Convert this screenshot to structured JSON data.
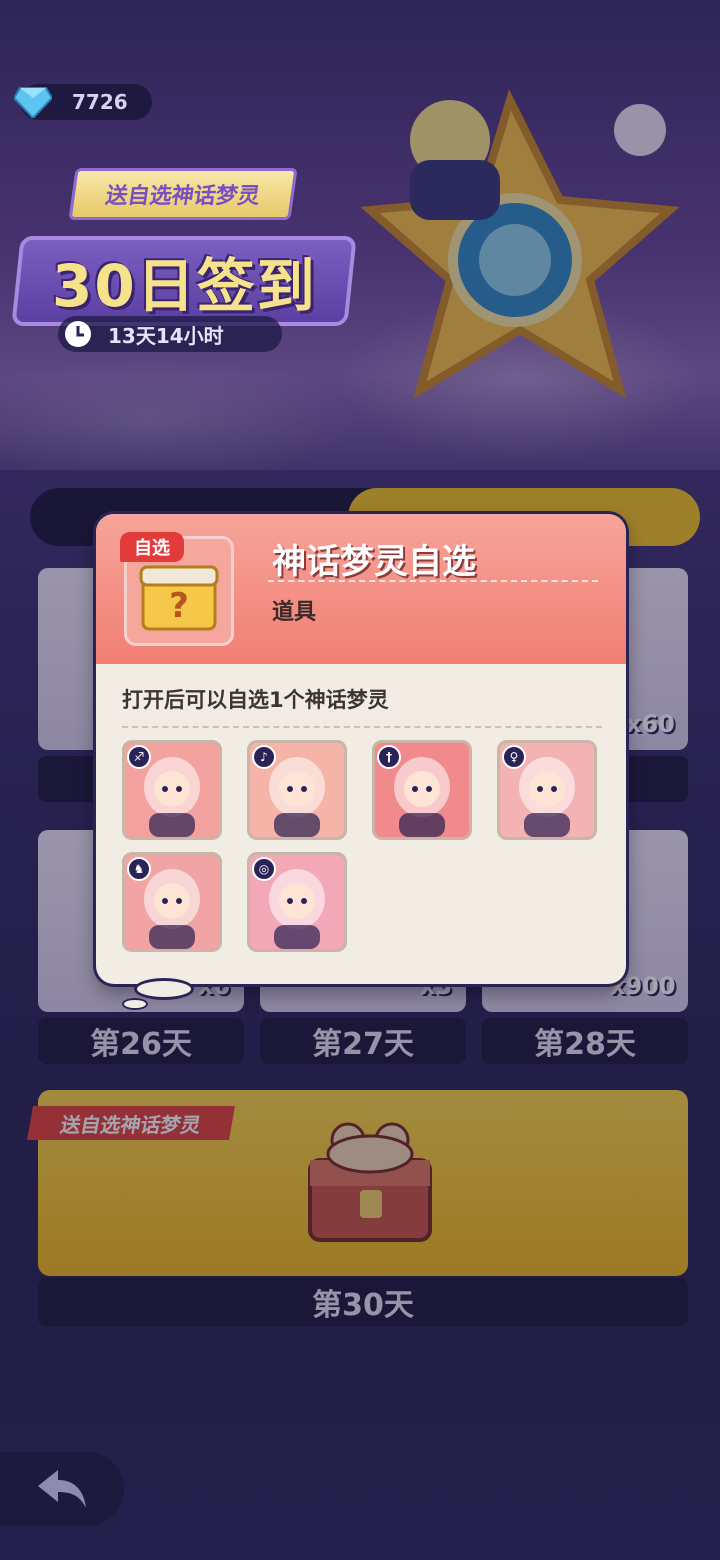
{
  "currency": {
    "gems": "7726"
  },
  "header": {
    "promo_tag": "送自选神话梦灵",
    "title": "30日签到",
    "timer": "13天14小时"
  },
  "grid": {
    "tiles": [
      {
        "label": "第26天",
        "qty": "x6"
      },
      {
        "label": "第27天",
        "qty": "x3"
      },
      {
        "label": "第28天",
        "qty": "x900"
      }
    ],
    "row_above_qty": "x60",
    "final": {
      "tag": "送自选神话梦灵",
      "label": "第30天"
    }
  },
  "popup": {
    "item_tag": "自选",
    "item_name": "神话梦灵自选",
    "item_type": "道具",
    "description": "打开后可以自选1个神话梦灵",
    "characters": [
      {
        "name": "char-1",
        "bg": "#f4a2a0",
        "badge": "♐"
      },
      {
        "name": "char-2",
        "bg": "#f6b4a8",
        "badge": "♪"
      },
      {
        "name": "char-3",
        "bg": "#f08a8c",
        "badge": "†"
      },
      {
        "name": "char-4",
        "bg": "#f3b2b4",
        "badge": "♀"
      },
      {
        "name": "char-5",
        "bg": "#f2a4a4",
        "badge": "♞"
      },
      {
        "name": "char-6",
        "bg": "#f3a8b8",
        "badge": "◎"
      }
    ]
  },
  "colors": {
    "accent_gold": "#f2c62a",
    "popup_header": "#f17f73",
    "tag_red": "#e23c3a"
  }
}
